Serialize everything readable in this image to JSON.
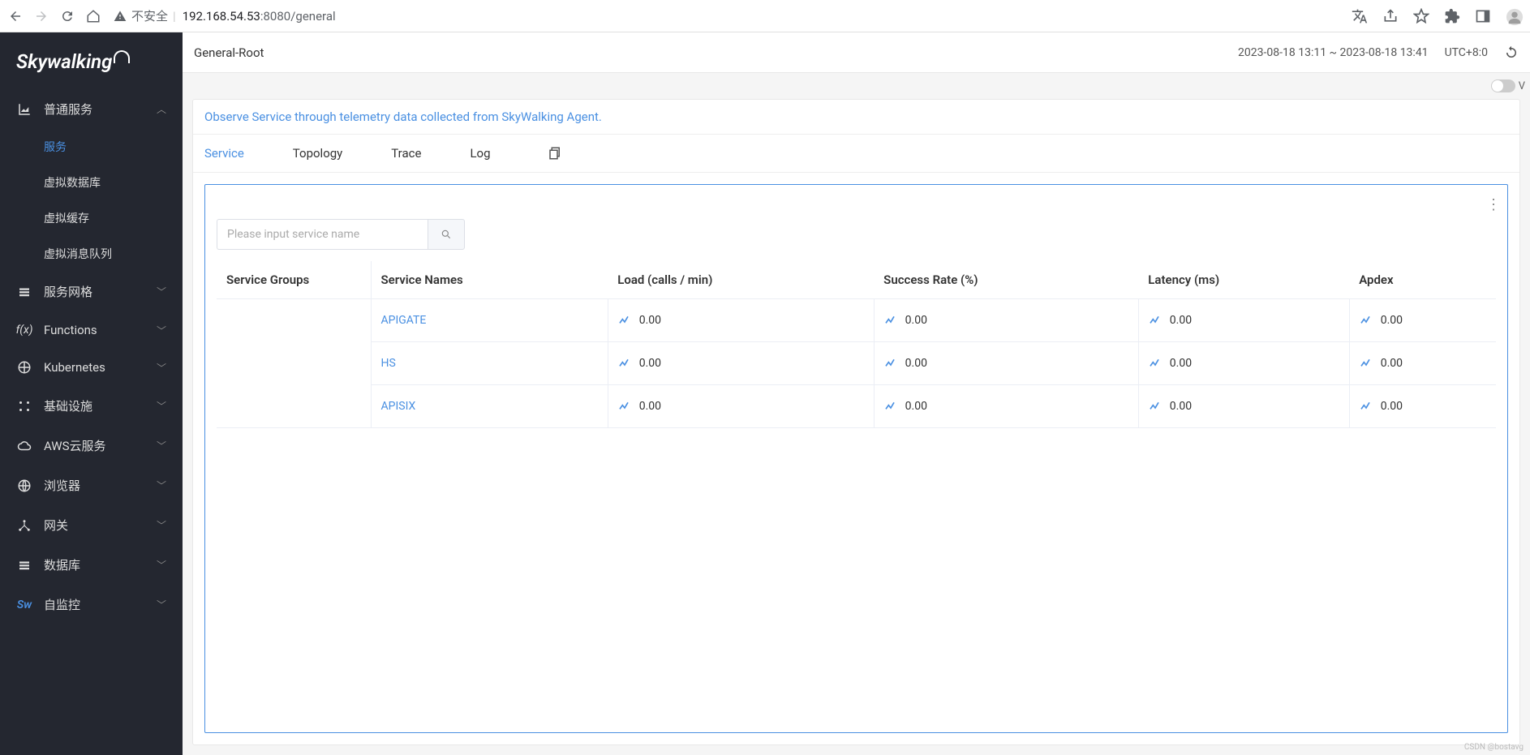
{
  "browser": {
    "insecure_label": "不安全",
    "url_host": "192.168.54.53",
    "url_port": ":8080",
    "url_path": "/general"
  },
  "logo": "Skywalking",
  "sidebar": {
    "items": [
      {
        "label": "普通服务",
        "expanded": true,
        "sub": [
          {
            "label": "服务",
            "active": true
          },
          {
            "label": "虚拟数据库"
          },
          {
            "label": "虚拟缓存"
          },
          {
            "label": "虚拟消息队列"
          }
        ]
      },
      {
        "label": "服务网格"
      },
      {
        "label": "Functions"
      },
      {
        "label": "Kubernetes"
      },
      {
        "label": "基础设施"
      },
      {
        "label": "AWS云服务"
      },
      {
        "label": "浏览器"
      },
      {
        "label": "网关"
      },
      {
        "label": "数据库"
      },
      {
        "label": "自监控"
      }
    ]
  },
  "topbar": {
    "breadcrumb": "General-Root",
    "timerange": "2023-08-18 13:11 ~ 2023-08-18 13:41",
    "timezone": "UTC+8:0"
  },
  "toggle_label": "V",
  "card": {
    "description": "Observe Service through telemetry data collected from SkyWalking Agent.",
    "tabs": [
      "Service",
      "Topology",
      "Trace",
      "Log"
    ],
    "active_tab": 0,
    "search_placeholder": "Please input service name",
    "columns": [
      "Service Groups",
      "Service Names",
      "Load (calls / min)",
      "Success Rate (%)",
      "Latency (ms)",
      "Apdex"
    ],
    "rows": [
      {
        "group": "",
        "name": "APIGATE",
        "load": "0.00",
        "success": "0.00",
        "latency": "0.00",
        "apdex": "0.00"
      },
      {
        "group": "",
        "name": "HS",
        "load": "0.00",
        "success": "0.00",
        "latency": "0.00",
        "apdex": "0.00"
      },
      {
        "group": "",
        "name": "APISIX",
        "load": "0.00",
        "success": "0.00",
        "latency": "0.00",
        "apdex": "0.00"
      }
    ]
  },
  "watermark": "CSDN @bostavg"
}
